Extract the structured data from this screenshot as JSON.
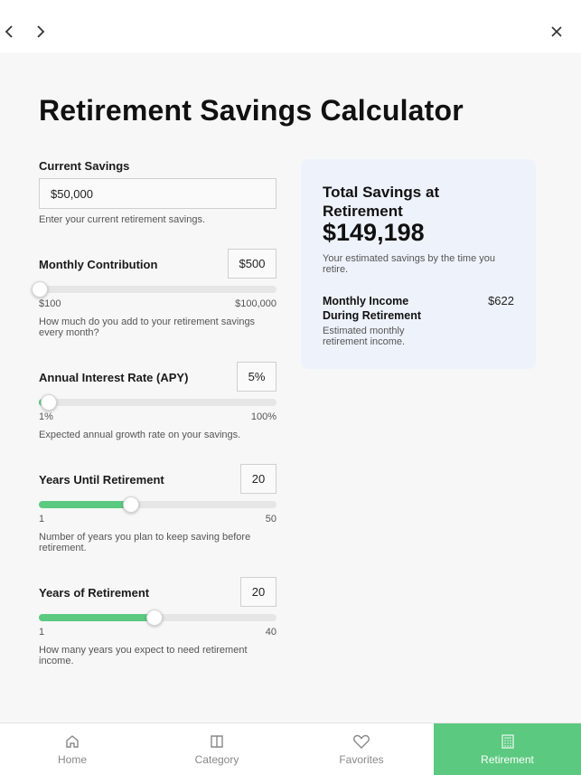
{
  "title": "Retirement Savings Calculator",
  "current_savings": {
    "label": "Current Savings",
    "value": "$50,000",
    "help": "Enter your current retirement savings."
  },
  "monthly_contribution": {
    "label": "Monthly Contribution",
    "value": "$500",
    "min_label": "$100",
    "max_label": "$100,000",
    "slider_fraction": 0.004,
    "help": "How much do you add to your retirement savings every month?"
  },
  "interest_rate": {
    "label": "Annual Interest Rate (APY)",
    "value": "5%",
    "min_label": "1%",
    "max_label": "100%",
    "slider_fraction": 0.04,
    "help": "Expected annual growth rate on your savings."
  },
  "years_until": {
    "label": "Years Until Retirement",
    "value": "20",
    "min_label": "1",
    "max_label": "50",
    "slider_fraction": 0.388,
    "help": "Number of years you plan to keep saving before retirement."
  },
  "years_of": {
    "label": "Years of Retirement",
    "value": "20",
    "min_label": "1",
    "max_label": "40",
    "slider_fraction": 0.487,
    "help": "How many years you expect to need retirement income."
  },
  "summary": {
    "title": "Total Savings at Retirement",
    "total": "$149,198",
    "note": "Your estimated savings by the time you retire.",
    "monthly_label": "Monthly Income During Retirement",
    "monthly_value": "$622",
    "monthly_note": "Estimated monthly retirement income."
  },
  "tabs": [
    {
      "label": "Home",
      "icon": "home-icon",
      "active": false
    },
    {
      "label": "Category",
      "icon": "book-icon",
      "active": false
    },
    {
      "label": "Favorites",
      "icon": "heart-icon",
      "active": false
    },
    {
      "label": "Retirement",
      "icon": "calculator-icon",
      "active": true
    }
  ],
  "colors": {
    "accent": "#5bc97f",
    "card_bg": "#eef3fb",
    "page_bg": "#f7f7f7"
  }
}
